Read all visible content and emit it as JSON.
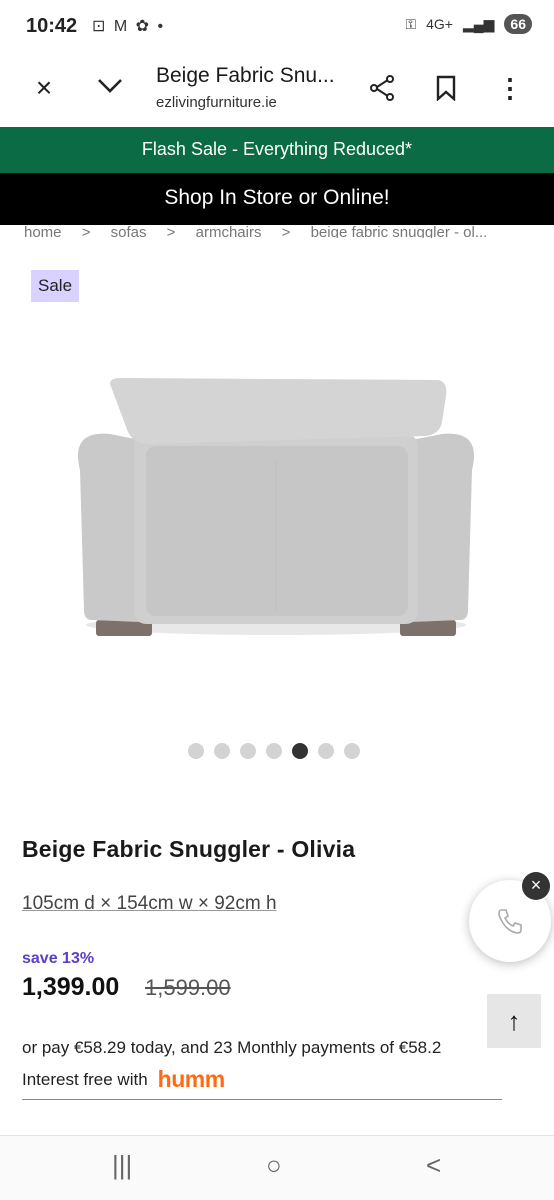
{
  "status": {
    "time": "10:42",
    "notifications": "⊡ M ✿ •",
    "network": "4G+",
    "battery": "66"
  },
  "browser": {
    "close_icon": "×",
    "chevron_icon": "⌄",
    "page_title": "Beige Fabric Snu...",
    "url": "ezlivingfurniture.ie",
    "share_icon": "share",
    "bookmark_icon": "bookmark",
    "menu_icon": "⋮"
  },
  "banners": {
    "flash": "Flash Sale - Everything Reduced*",
    "shop": "Shop In Store or Online!"
  },
  "breadcrumb": [
    "home",
    ">",
    "sofas",
    ">",
    "armchairs",
    ">",
    "beige fabric snuggler - ol..."
  ],
  "product": {
    "badge": "Sale",
    "name": "Beige Fabric Snuggler - Olivia",
    "dimensions": "105cm d × 154cm w × 92cm h",
    "save": "save 13%",
    "price": "1,399.00",
    "was_price": "1,599.00",
    "pay_text": "or pay €58.29 today, and 23 Monthly payments of €58.2",
    "interest_text": "Interest free with",
    "humm_logo": "humm"
  },
  "carousel": {
    "count": 7,
    "active_index": 4
  },
  "buttons": {
    "call_icon": "✆",
    "call_close": "×",
    "scroll_up": "↑"
  },
  "android_nav": {
    "recents": "|||",
    "home": "○",
    "back": "<"
  },
  "colors": {
    "flash_bg": "#0b6b45",
    "shop_bg": "#000000",
    "badge_bg": "#d9d1ff",
    "save_color": "#5b3fc6",
    "humm": "#ff6a13"
  }
}
